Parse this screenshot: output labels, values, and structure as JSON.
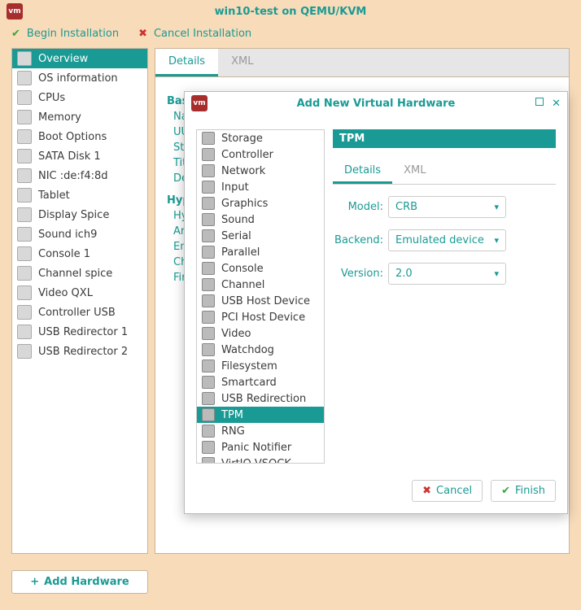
{
  "window_title": "win10-test on QEMU/KVM",
  "toolbar": {
    "begin": "Begin Installation",
    "cancel": "Cancel Installation"
  },
  "sidebar": {
    "items": [
      {
        "label": "Overview",
        "active": true,
        "icon": "monitor-icon"
      },
      {
        "label": "OS information",
        "icon": "os-icon"
      },
      {
        "label": "CPUs",
        "icon": "cpu-icon"
      },
      {
        "label": "Memory",
        "icon": "memory-icon"
      },
      {
        "label": "Boot Options",
        "icon": "boot-icon"
      },
      {
        "label": "SATA Disk 1",
        "icon": "disk-icon"
      },
      {
        "label": "NIC :de:f4:8d",
        "icon": "nic-icon"
      },
      {
        "label": "Tablet",
        "icon": "tablet-icon"
      },
      {
        "label": "Display Spice",
        "icon": "display-icon"
      },
      {
        "label": "Sound ich9",
        "icon": "sound-icon"
      },
      {
        "label": "Console 1",
        "icon": "console-icon"
      },
      {
        "label": "Channel spice",
        "icon": "channel-icon"
      },
      {
        "label": "Video QXL",
        "icon": "video-icon"
      },
      {
        "label": "Controller USB",
        "icon": "controller-icon"
      },
      {
        "label": "USB Redirector 1",
        "icon": "usb-icon"
      },
      {
        "label": "USB Redirector 2",
        "icon": "usb-icon"
      }
    ]
  },
  "content_tabs": {
    "details": "Details",
    "xml": "XML"
  },
  "details_body": {
    "section1": "Basic",
    "rows1": [
      "Nam",
      "UUI",
      "Sta",
      "Titl",
      "Des"
    ],
    "section2": "Hype",
    "rows2": [
      "Hyp",
      "Arc",
      "Em",
      "Chi",
      "Firm"
    ]
  },
  "add_hw_button": "Add Hardware",
  "modal": {
    "title": "Add New Virtual Hardware",
    "panel_title": "TPM",
    "hw_items": [
      "Storage",
      "Controller",
      "Network",
      "Input",
      "Graphics",
      "Sound",
      "Serial",
      "Parallel",
      "Console",
      "Channel",
      "USB Host Device",
      "PCI Host Device",
      "Video",
      "Watchdog",
      "Filesystem",
      "Smartcard",
      "USB Redirection",
      "TPM",
      "RNG",
      "Panic Notifier",
      "VirtIO VSOCK"
    ],
    "selected_hw": "TPM",
    "sub_tabs": {
      "details": "Details",
      "xml": "XML"
    },
    "form": {
      "model_label": "Model:",
      "model_value": "CRB",
      "backend_label": "Backend:",
      "backend_value": "Emulated device",
      "version_label": "Version:",
      "version_value": "2.0"
    },
    "buttons": {
      "cancel": "Cancel",
      "finish": "Finish"
    }
  }
}
